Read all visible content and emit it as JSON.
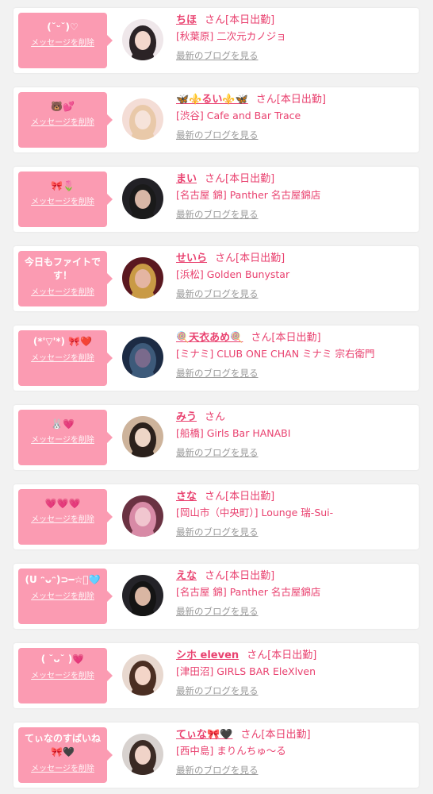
{
  "delete_label": "メッセージを削除",
  "blog_label": "最新のブログを見る",
  "colors": {
    "accent": "#e9416f",
    "bubble": "#fb9bb2",
    "background": "#f2f2f2"
  },
  "messages": [
    {
      "message": "(˘ᵕ˘)♡",
      "name": "ちほ",
      "suffix": "さん[本日出勤]",
      "shop": "[秋葉原] 二次元カノジョ",
      "avatar": [
        "#efe7ea",
        "#2b2326",
        "#f3d7cc"
      ]
    },
    {
      "message": "🐻💕",
      "name": "🦋⚜️るい⚜️🦋",
      "suffix": "さん[本日出勤]",
      "shop": "[渋谷] Cafe and Bar Trace",
      "avatar": [
        "#f4ddd6",
        "#e9c9a9",
        "#f6e3da"
      ]
    },
    {
      "message": "🎀🌷",
      "name": "まい",
      "suffix": "さん[本日出勤]",
      "shop": "[名古屋 錦] Panther 名古屋錦店",
      "avatar": [
        "#222126",
        "#1a1a1a",
        "#d8b7a6"
      ]
    },
    {
      "message": "今日もファイトです！",
      "name": "せいら",
      "suffix": "さん[本日出勤]",
      "shop": "[浜松] Golden Bunystar",
      "avatar": [
        "#5a1820",
        "#c99a45",
        "#e4b5a2"
      ]
    },
    {
      "message": "(*'▽'*) 🎀❤️",
      "name": "🍭天衣あめ🍭",
      "suffix": "さん[本日出勤]",
      "shop": "[ミナミ] CLUB ONE CHAN ミナミ 宗右衛門",
      "avatar": [
        "#1c2b44",
        "#3d5a7a",
        "#7a6a8c"
      ]
    },
    {
      "message": "🐰💗",
      "name": "みう",
      "suffix": "さん",
      "shop": "[船橋] Girls Bar HANABI",
      "avatar": [
        "#cdb39b",
        "#2b211c",
        "#eed6c7"
      ]
    },
    {
      "message": "💗💗💗",
      "name": "さな",
      "suffix": "さん[本日出勤]",
      "shop": "[岡山市（中央町）] Lounge 瑞-Sui-",
      "avatar": [
        "#6a3242",
        "#d88aa6",
        "#f1c6cf"
      ]
    },
    {
      "message": "(U ᵔᴗᵔ)⊃━☆゚🩵",
      "name": "えな",
      "suffix": "さん[本日出勤]",
      "shop": "[名古屋 錦] Panther 名古屋錦店",
      "avatar": [
        "#242328",
        "#141414",
        "#d9b6a3"
      ]
    },
    {
      "message": "( ˘ᴗ˘ )💗",
      "name": "シホ eleven",
      "suffix": "さん[本日出勤]",
      "shop": "[津田沼] GIRLS BAR EleXlven",
      "avatar": [
        "#e8d8cf",
        "#4a2e22",
        "#f3d5c8"
      ]
    },
    {
      "message": "てぃなのすばいね🎀🖤",
      "name": "てぃな🎀🖤",
      "suffix": "さん[本日出勤]",
      "shop": "[西中島] まりんちゅ〜る",
      "avatar": [
        "#d8d2cf",
        "#3a2a24",
        "#f0d3c8"
      ]
    }
  ]
}
